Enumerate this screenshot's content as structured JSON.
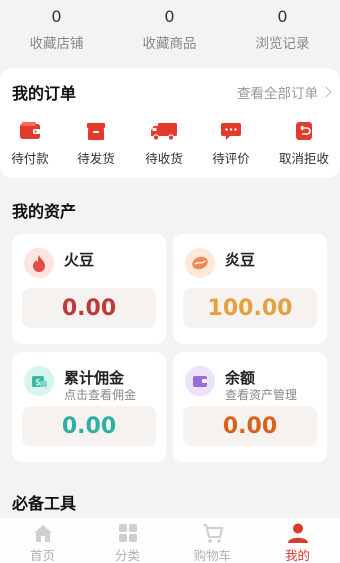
{
  "stats": [
    {
      "count": "0",
      "label": "收藏店铺"
    },
    {
      "count": "0",
      "label": "收藏商品"
    },
    {
      "count": "0",
      "label": "浏览记录"
    }
  ],
  "orders": {
    "title": "我的订单",
    "view_all": "查看全部订单",
    "items": [
      {
        "label": "待付款",
        "icon": "wallet-icon"
      },
      {
        "label": "待发货",
        "icon": "package-icon"
      },
      {
        "label": "待收货",
        "icon": "truck-icon"
      },
      {
        "label": "待评价",
        "icon": "comment-icon"
      },
      {
        "label": "取消拒收",
        "icon": "return-icon"
      }
    ]
  },
  "assets": {
    "title": "我的资产",
    "items": [
      {
        "name": "火豆",
        "subtitle": "",
        "value": "0.00",
        "value_color": "#c0393a",
        "icon": "fire-icon"
      },
      {
        "name": "炎豆",
        "subtitle": "",
        "value": "100.00",
        "value_color": "#e6a03f",
        "icon": "bean-icon"
      },
      {
        "name": "累计佣金",
        "subtitle": "点击查看佣金",
        "value": "0.00",
        "value_color": "#2fb0a6",
        "icon": "money-icon"
      },
      {
        "name": "余额",
        "subtitle": "查看资产管理",
        "value": "0.00",
        "value_color": "#d9631c",
        "icon": "purse-icon"
      }
    ]
  },
  "tools": {
    "title": "必备工具"
  },
  "tabbar": {
    "items": [
      {
        "label": "首页",
        "icon": "home-icon",
        "active": false
      },
      {
        "label": "分类",
        "icon": "grid-icon",
        "active": false
      },
      {
        "label": "购物车",
        "icon": "cart-icon",
        "active": false
      },
      {
        "label": "我的",
        "icon": "user-icon",
        "active": true
      }
    ]
  },
  "colors": {
    "accent": "#d93a2b",
    "background": "#f3f3f3"
  }
}
